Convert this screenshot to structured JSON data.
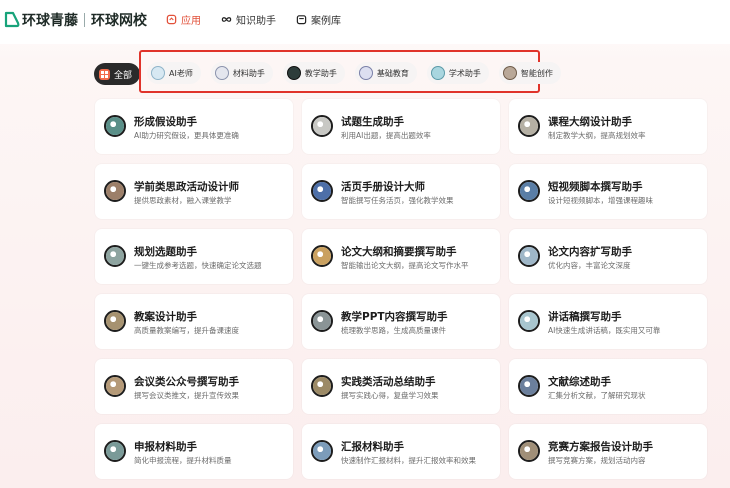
{
  "brand": {
    "name_left": "环球青藤",
    "name_right": "环球网校"
  },
  "nav": [
    {
      "label": "应用",
      "icon": "home-icon",
      "active": true
    },
    {
      "label": "知识助手",
      "icon": "infinity-icon",
      "active": false
    },
    {
      "label": "案例库",
      "icon": "library-icon",
      "active": false
    }
  ],
  "filters": {
    "all_label": "全部",
    "items": [
      {
        "label": "AI老师",
        "icon": "ai-teacher-icon",
        "color": "#d7e8f2"
      },
      {
        "label": "材料助手",
        "icon": "materials-icon",
        "color": "#e4e6ee"
      },
      {
        "label": "教学助手",
        "icon": "teaching-icon",
        "color": "#2d3c3a"
      },
      {
        "label": "基础教育",
        "icon": "basic-education-icon",
        "color": "#dcdff0"
      },
      {
        "label": "学术助手",
        "icon": "academic-icon",
        "color": "#a9d6df"
      },
      {
        "label": "智能创作",
        "icon": "creation-icon",
        "color": "#b9a898"
      }
    ]
  },
  "cards": [
    {
      "title": "形成假设助手",
      "desc": "AI助力研究假设，更具体更准确",
      "icon": "hypothesis-icon",
      "color": "#5a8f88"
    },
    {
      "title": "试题生成助手",
      "desc": "利用AI出题，提高出题效率",
      "icon": "exam-icon",
      "color": "#c8c8c4"
    },
    {
      "title": "课程大纲设计助手",
      "desc": "制定教学大纲，提高规划效率",
      "icon": "syllabus-icon",
      "color": "#b5b0a4"
    },
    {
      "title": "学前类思政活动设计师",
      "desc": "提供思政素材，融入课堂教学",
      "icon": "preschool-icon",
      "color": "#9c7f69"
    },
    {
      "title": "活页手册设计大师",
      "desc": "智能撰写任务活页，强化教学效果",
      "icon": "handbook-icon",
      "color": "#4d6fa8"
    },
    {
      "title": "短视频脚本撰写助手",
      "desc": "设计短视频脚本，增强课程趣味",
      "icon": "video-script-icon",
      "color": "#5a7ea6"
    },
    {
      "title": "规划选题助手",
      "desc": "一键生成参考选题，快速确定论文选题",
      "icon": "topic-icon",
      "color": "#8ea4a0"
    },
    {
      "title": "论文大纲和摘要撰写助手",
      "desc": "智能输出论文大纲，提高论文写作水平",
      "icon": "outline-icon",
      "color": "#caa160"
    },
    {
      "title": "论文内容扩写助手",
      "desc": "优化内容，丰富论文深度",
      "icon": "expand-icon",
      "color": "#9fb7c8"
    },
    {
      "title": "教案设计助手",
      "desc": "高质量教案编写，提升备课速度",
      "icon": "lesson-plan-icon",
      "color": "#a69270"
    },
    {
      "title": "教学PPT内容撰写助手",
      "desc": "梳理教学思路，生成高质量课件",
      "icon": "ppt-icon",
      "color": "#8a9496"
    },
    {
      "title": "讲话稿撰写助手",
      "desc": "AI快速生成讲话稿，既实用又可靠",
      "icon": "speech-icon",
      "color": "#a8c6cf"
    },
    {
      "title": "会议类公众号撰写助手",
      "desc": "撰写会议类推文，提升宣传效果",
      "icon": "meeting-icon",
      "color": "#b59a78"
    },
    {
      "title": "实践类活动总结助手",
      "desc": "撰写实践心得，复盘学习效果",
      "icon": "practice-icon",
      "color": "#9c8a66"
    },
    {
      "title": "文献综述助手",
      "desc": "汇集分析文献，了解研究现状",
      "icon": "literature-icon",
      "color": "#6b7f9c"
    },
    {
      "title": "申报材料助手",
      "desc": "简化申报流程，提升材料质量",
      "icon": "application-icon",
      "color": "#7a9a98"
    },
    {
      "title": "汇报材料助手",
      "desc": "快速制作汇报材料，提升汇报效率和效果",
      "icon": "report-icon",
      "color": "#7c9cba"
    },
    {
      "title": "竞赛方案报告设计助手",
      "desc": "撰写竞赛方案，规划活动内容",
      "icon": "competition-icon",
      "color": "#a08f78"
    }
  ]
}
